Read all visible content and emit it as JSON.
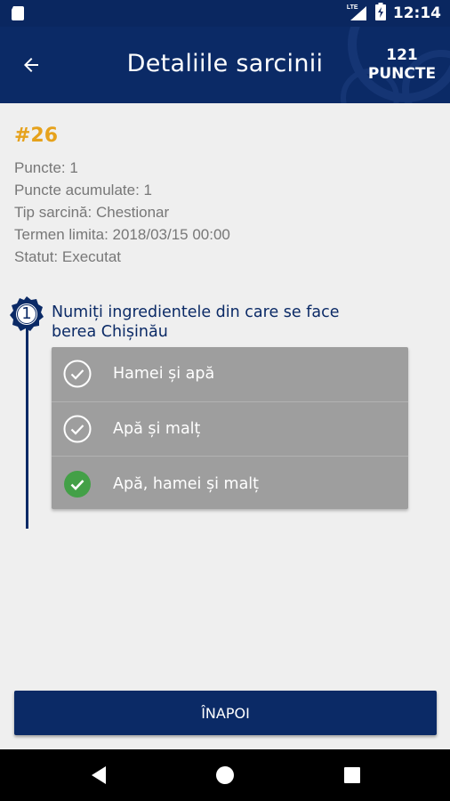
{
  "status_bar": {
    "time": "12:14",
    "network_label": "LTE",
    "icons": [
      "sd-card-icon",
      "lte-signal-icon",
      "battery-charging-icon"
    ]
  },
  "app_bar": {
    "title": "Detaliile sarcinii",
    "points_value": "121",
    "points_label": "PUNCTE",
    "back_icon": "arrow-back-icon"
  },
  "task": {
    "id": "#26",
    "details": [
      "Puncte: 1",
      "Puncte acumulate: 1",
      "Tip sarcină: Chestionar",
      "Termen limita: 2018/03/15 00:00",
      "Statut: Executat"
    ]
  },
  "question": {
    "number": "1",
    "text": "Numiți ingredientele din care se face berea Chișinău",
    "answers": [
      {
        "label": "Hamei și apă",
        "correct": false
      },
      {
        "label": "Apă și malț",
        "correct": false
      },
      {
        "label": "Apă, hamei și malț",
        "correct": true
      }
    ]
  },
  "footer": {
    "back_button": "ÎNAPOI"
  },
  "colors": {
    "primary": "#0b2a66",
    "accent": "#e6a21c",
    "answer_bg": "#9e9e9e",
    "correct": "#43a047"
  }
}
